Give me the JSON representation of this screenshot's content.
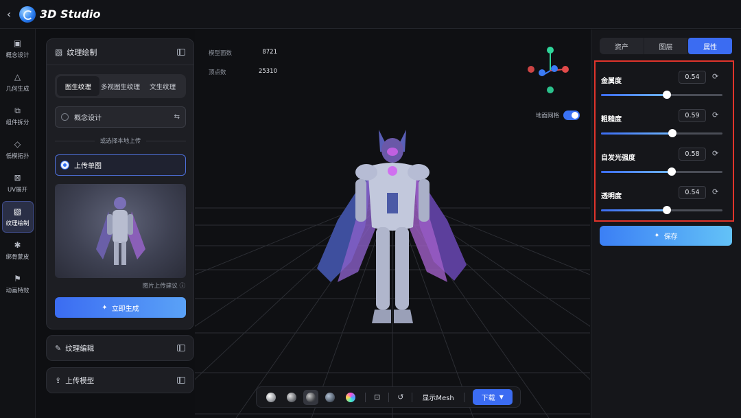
{
  "header": {
    "back_icon": "chevron-left-icon",
    "logo_icon": "app-logo-icon",
    "title": "3D Studio"
  },
  "rail": [
    {
      "id": "concept",
      "icon": "image-icon",
      "label": "概念设计",
      "active": false
    },
    {
      "id": "geometry",
      "icon": "shapes-icon",
      "label": "几何生成",
      "active": false
    },
    {
      "id": "split",
      "icon": "component-icon",
      "label": "组件拆分",
      "active": false
    },
    {
      "id": "lowpoly",
      "icon": "polygon-icon",
      "label": "低模拓扑",
      "active": false
    },
    {
      "id": "uv",
      "icon": "uv-icon",
      "label": "UV展开",
      "active": false
    },
    {
      "id": "texture",
      "icon": "texture-icon",
      "label": "纹理绘制",
      "active": true
    },
    {
      "id": "rig",
      "icon": "skeleton-icon",
      "label": "绑骨蒙皮",
      "active": false
    },
    {
      "id": "anim",
      "icon": "run-icon",
      "label": "动画特效",
      "active": false
    }
  ],
  "texture_panel": {
    "title": "纹理绘制",
    "tabs": [
      {
        "label": "图生纹理",
        "active": true
      },
      {
        "label": "多视图生纹理",
        "active": false
      },
      {
        "label": "文生纹理",
        "active": false
      }
    ],
    "concept_option": "概念设计",
    "divider_text": "或选择本地上传",
    "upload_option": "上传单图",
    "hint": "图片上传建议 ⓘ",
    "generate_label": "立即生成"
  },
  "texture_edit": {
    "title": "纹理编辑"
  },
  "upload_model": {
    "title": "上传模型"
  },
  "viewport": {
    "stats": [
      {
        "label": "模型面数",
        "value": "8721"
      },
      {
        "label": "顶点数",
        "value": "25310"
      }
    ],
    "grid_label": "地面网格",
    "grid_on": true
  },
  "toolbar": {
    "materials": [
      "matte-sphere-icon",
      "clay-sphere-icon",
      "normal-sphere-icon",
      "metal-sphere-icon",
      "rainbow-sphere-icon"
    ],
    "show_mesh": "显示Mesh",
    "download": "下载"
  },
  "right_panel": {
    "tabs": [
      {
        "label": "资产",
        "active": false
      },
      {
        "label": "图层",
        "active": false
      },
      {
        "label": "属性",
        "active": true
      }
    ],
    "properties": [
      {
        "name": "金属度",
        "value": "0.54",
        "level": 0.54
      },
      {
        "name": "粗糙度",
        "value": "0.59",
        "level": 0.59
      },
      {
        "name": "自发光强度",
        "value": "0.58",
        "level": 0.58
      },
      {
        "name": "透明度",
        "value": "0.54",
        "level": 0.54
      }
    ],
    "save_label": "保存"
  }
}
